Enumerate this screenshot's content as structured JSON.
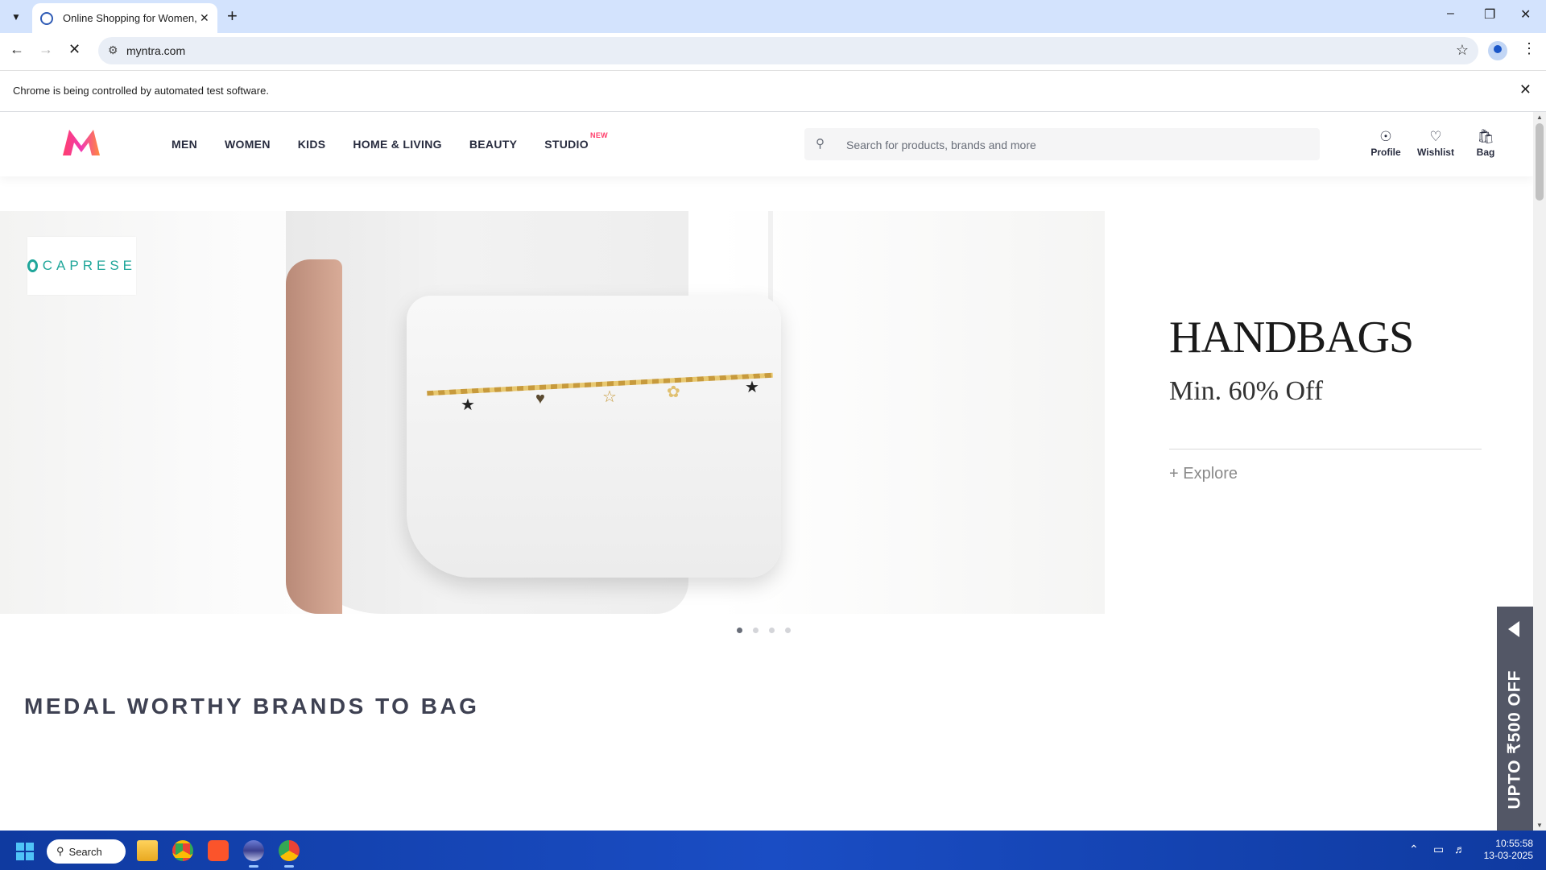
{
  "browser": {
    "tab_title": "Online Shopping for Women, M",
    "url": "myntra.com",
    "infobar_message": "Chrome is being controlled by automated test software."
  },
  "header": {
    "nav": [
      {
        "label": "MEN"
      },
      {
        "label": "WOMEN"
      },
      {
        "label": "KIDS"
      },
      {
        "label": "HOME & LIVING"
      },
      {
        "label": "BEAUTY"
      },
      {
        "label": "STUDIO",
        "badge": "NEW"
      }
    ],
    "search_placeholder": "Search for products, brands and more",
    "actions": [
      {
        "label": "Profile",
        "icon": "profile-icon"
      },
      {
        "label": "Wishlist",
        "icon": "heart-icon"
      },
      {
        "label": "Bag",
        "icon": "bag-icon"
      }
    ]
  },
  "hero": {
    "brand": "CAPRESE",
    "title": "HANDBAGS",
    "subtitle": "Min. 60% Off",
    "cta": "+ Explore",
    "slide_count": 4,
    "active_slide": 1
  },
  "section": {
    "title": "MEDAL WORTHY BRANDS TO BAG"
  },
  "offer_tab": {
    "text": "UPTO ₹500 OFF"
  },
  "taskbar": {
    "search_label": "Search",
    "time": "10:55:58",
    "date": "13-03-2025"
  },
  "colors": {
    "brand_pink": "#ff3f6c",
    "text_dark": "#282c3f",
    "taskbar_blue": "#1a4dc4"
  }
}
